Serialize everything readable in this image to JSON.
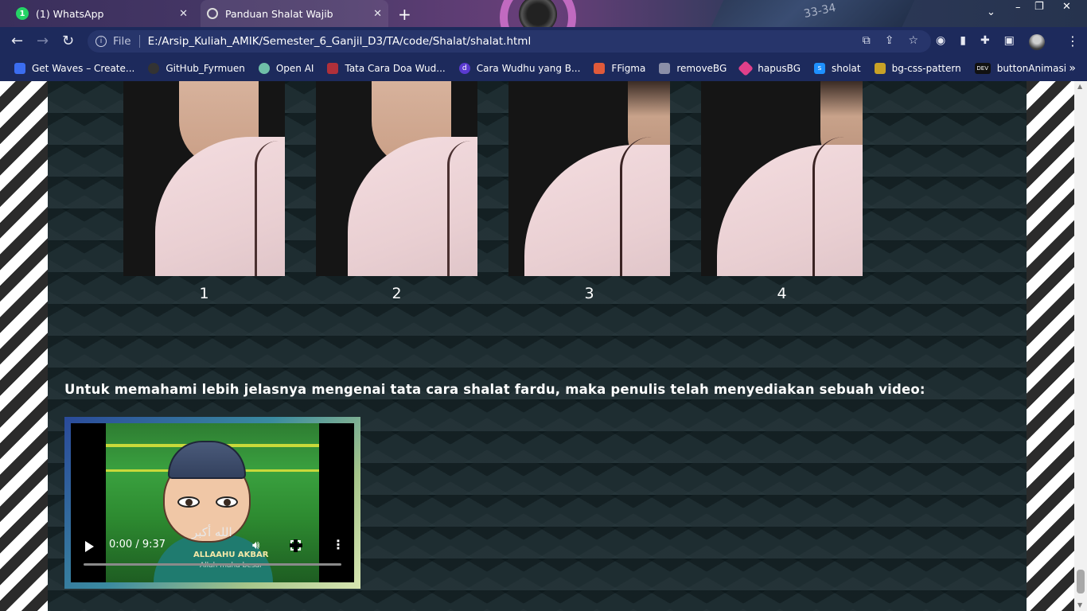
{
  "browser": {
    "tabs": [
      {
        "title": "(1) WhatsApp",
        "badge": "1",
        "active": false
      },
      {
        "title": "Panduan Shalat Wajib",
        "active": true
      }
    ],
    "tab_close_glyph": "✕",
    "new_tab_glyph": "+",
    "decor_text": "33-34",
    "window_controls": {
      "minimize": "–",
      "maximize": "❐",
      "close": "✕"
    },
    "address": {
      "scheme_label": "File",
      "url": "E:/Arsip_Kuliah_AMIK/Semester_6_Ganjil_D3/TA/code/Shalat/shalat.html"
    },
    "bookmarks": [
      {
        "label": "Get Waves – Create...",
        "icon": "waves-icon",
        "color": "#3b6df0"
      },
      {
        "label": "GitHub_Fyrmuen",
        "icon": "github-icon",
        "color": "#333333"
      },
      {
        "label": "Open AI",
        "icon": "openai-icon",
        "color": "#6fbfa8"
      },
      {
        "label": "Tata Cara Doa Wud...",
        "icon": "site-icon",
        "color": "#b0303a"
      },
      {
        "label": "Cara Wudhu yang B...",
        "icon": "d-icon",
        "color": "#5a3ad0",
        "glyph": "d"
      },
      {
        "label": "FFigma",
        "icon": "figma-icon",
        "color": "#e05a3a"
      },
      {
        "label": "removeBG",
        "icon": "layers-icon",
        "color": "#8b8fa8"
      },
      {
        "label": "hapusBG",
        "icon": "diamond-icon",
        "color": "#e0408a"
      },
      {
        "label": "sholat",
        "icon": "s-icon",
        "color": "#1e90ff",
        "glyph": "s"
      },
      {
        "label": "bg-css-pattern",
        "icon": "bolt-icon",
        "color": "#c9a227"
      },
      {
        "label": "buttonAnimasi",
        "icon": "dev-icon",
        "color": "#111111",
        "glyph": "DEV"
      }
    ],
    "overflow_glyph": "»"
  },
  "page": {
    "steps": [
      {
        "caption": "1",
        "variant": "front"
      },
      {
        "caption": "2",
        "variant": "front"
      },
      {
        "caption": "3",
        "variant": "back"
      },
      {
        "caption": "4",
        "variant": "back"
      }
    ],
    "intro_text": "Untuk memahami lebih jelasnya mengenai tata cara shalat fardu, maka penulis telah menyediakan sebuah video:",
    "video": {
      "current_time": "0:00",
      "duration": "9:37",
      "time_display": "0:00 / 9:37",
      "progress": 0,
      "overlay_arabic": "الله أكبر",
      "overlay_latin": "ALLAAHU AKBAR",
      "overlay_translation": "Allah maha besar"
    }
  }
}
